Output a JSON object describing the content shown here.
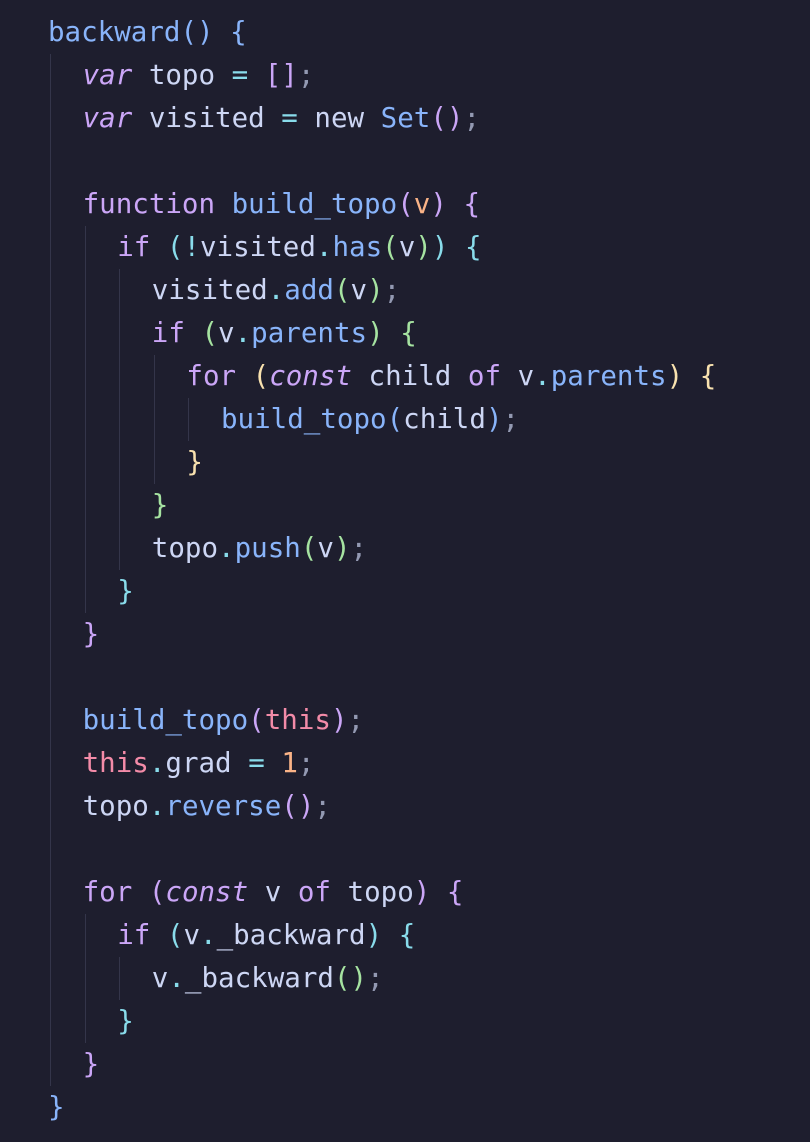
{
  "editor": {
    "lines": [
      {
        "indent": 0,
        "tokens": [
          {
            "t": "backward",
            "c": "fn"
          },
          {
            "t": "()",
            "c": "b6"
          },
          {
            "t": " ",
            "c": "vr"
          },
          {
            "t": "{",
            "c": "b6"
          }
        ]
      },
      {
        "indent": 1,
        "tokens": [
          {
            "t": "var",
            "c": "st"
          },
          {
            "t": " topo ",
            "c": "vr"
          },
          {
            "t": "=",
            "c": "op"
          },
          {
            "t": " ",
            "c": "vr"
          },
          {
            "t": "[]",
            "c": "b2"
          },
          {
            "t": ";",
            "c": "pc"
          }
        ]
      },
      {
        "indent": 1,
        "tokens": [
          {
            "t": "var",
            "c": "st"
          },
          {
            "t": " visited ",
            "c": "vr"
          },
          {
            "t": "=",
            "c": "op"
          },
          {
            "t": " new ",
            "c": "ty"
          },
          {
            "t": "Set",
            "c": "fn"
          },
          {
            "t": "()",
            "c": "b2"
          },
          {
            "t": ";",
            "c": "pc"
          }
        ]
      },
      {
        "indent": 0,
        "tokens": []
      },
      {
        "indent": 1,
        "tokens": [
          {
            "t": "function",
            "c": "kw"
          },
          {
            "t": " ",
            "c": "vr"
          },
          {
            "t": "build_topo",
            "c": "fn"
          },
          {
            "t": "(",
            "c": "b2"
          },
          {
            "t": "v",
            "c": "pm"
          },
          {
            "t": ")",
            "c": "b2"
          },
          {
            "t": " ",
            "c": "vr"
          },
          {
            "t": "{",
            "c": "b2"
          }
        ]
      },
      {
        "indent": 2,
        "tokens": [
          {
            "t": "if",
            "c": "kw"
          },
          {
            "t": " ",
            "c": "vr"
          },
          {
            "t": "(",
            "c": "b3"
          },
          {
            "t": "!",
            "c": "op"
          },
          {
            "t": "visited",
            "c": "vr"
          },
          {
            "t": ".",
            "c": "op"
          },
          {
            "t": "has",
            "c": "fn"
          },
          {
            "t": "(",
            "c": "b4"
          },
          {
            "t": "v",
            "c": "vr"
          },
          {
            "t": ")",
            "c": "b4"
          },
          {
            "t": ")",
            "c": "b3"
          },
          {
            "t": " ",
            "c": "vr"
          },
          {
            "t": "{",
            "c": "b3"
          }
        ]
      },
      {
        "indent": 3,
        "tokens": [
          {
            "t": "visited",
            "c": "vr"
          },
          {
            "t": ".",
            "c": "op"
          },
          {
            "t": "add",
            "c": "fn"
          },
          {
            "t": "(",
            "c": "b4"
          },
          {
            "t": "v",
            "c": "vr"
          },
          {
            "t": ")",
            "c": "b4"
          },
          {
            "t": ";",
            "c": "pc"
          }
        ]
      },
      {
        "indent": 3,
        "tokens": [
          {
            "t": "if",
            "c": "kw"
          },
          {
            "t": " ",
            "c": "vr"
          },
          {
            "t": "(",
            "c": "b4"
          },
          {
            "t": "v",
            "c": "vr"
          },
          {
            "t": ".",
            "c": "op"
          },
          {
            "t": "parents",
            "c": "fn"
          },
          {
            "t": ")",
            "c": "b4"
          },
          {
            "t": " ",
            "c": "vr"
          },
          {
            "t": "{",
            "c": "b4"
          }
        ]
      },
      {
        "indent": 4,
        "tokens": [
          {
            "t": "for",
            "c": "kw"
          },
          {
            "t": " ",
            "c": "vr"
          },
          {
            "t": "(",
            "c": "b5"
          },
          {
            "t": "const",
            "c": "st"
          },
          {
            "t": " child ",
            "c": "vr"
          },
          {
            "t": "of",
            "c": "kw"
          },
          {
            "t": " v",
            "c": "vr"
          },
          {
            "t": ".",
            "c": "op"
          },
          {
            "t": "parents",
            "c": "fn"
          },
          {
            "t": ")",
            "c": "b5"
          },
          {
            "t": " ",
            "c": "vr"
          },
          {
            "t": "{",
            "c": "b5"
          }
        ]
      },
      {
        "indent": 5,
        "tokens": [
          {
            "t": "build_topo",
            "c": "fn"
          },
          {
            "t": "(",
            "c": "b6"
          },
          {
            "t": "child",
            "c": "vr"
          },
          {
            "t": ")",
            "c": "b6"
          },
          {
            "t": ";",
            "c": "pc"
          }
        ]
      },
      {
        "indent": 4,
        "tokens": [
          {
            "t": "}",
            "c": "b5"
          }
        ]
      },
      {
        "indent": 3,
        "tokens": [
          {
            "t": "}",
            "c": "b4"
          }
        ]
      },
      {
        "indent": 3,
        "tokens": [
          {
            "t": "topo",
            "c": "vr"
          },
          {
            "t": ".",
            "c": "op"
          },
          {
            "t": "push",
            "c": "fn"
          },
          {
            "t": "(",
            "c": "b4"
          },
          {
            "t": "v",
            "c": "vr"
          },
          {
            "t": ")",
            "c": "b4"
          },
          {
            "t": ";",
            "c": "pc"
          }
        ]
      },
      {
        "indent": 2,
        "tokens": [
          {
            "t": "}",
            "c": "b3"
          }
        ]
      },
      {
        "indent": 1,
        "tokens": [
          {
            "t": "}",
            "c": "b2"
          }
        ]
      },
      {
        "indent": 0,
        "tokens": []
      },
      {
        "indent": 1,
        "tokens": [
          {
            "t": "build_topo",
            "c": "fn"
          },
          {
            "t": "(",
            "c": "b2"
          },
          {
            "t": "this",
            "c": "sl"
          },
          {
            "t": ")",
            "c": "b2"
          },
          {
            "t": ";",
            "c": "pc"
          }
        ]
      },
      {
        "indent": 1,
        "tokens": [
          {
            "t": "this",
            "c": "sl"
          },
          {
            "t": ".",
            "c": "op"
          },
          {
            "t": "grad ",
            "c": "vr"
          },
          {
            "t": "=",
            "c": "op"
          },
          {
            "t": " ",
            "c": "vr"
          },
          {
            "t": "1",
            "c": "nm"
          },
          {
            "t": ";",
            "c": "pc"
          }
        ]
      },
      {
        "indent": 1,
        "tokens": [
          {
            "t": "topo",
            "c": "vr"
          },
          {
            "t": ".",
            "c": "op"
          },
          {
            "t": "reverse",
            "c": "fn"
          },
          {
            "t": "()",
            "c": "b2"
          },
          {
            "t": ";",
            "c": "pc"
          }
        ]
      },
      {
        "indent": 0,
        "tokens": []
      },
      {
        "indent": 1,
        "tokens": [
          {
            "t": "for",
            "c": "kw"
          },
          {
            "t": " ",
            "c": "vr"
          },
          {
            "t": "(",
            "c": "b2"
          },
          {
            "t": "const",
            "c": "st"
          },
          {
            "t": " v ",
            "c": "vr"
          },
          {
            "t": "of",
            "c": "kw"
          },
          {
            "t": " topo",
            "c": "vr"
          },
          {
            "t": ")",
            "c": "b2"
          },
          {
            "t": " ",
            "c": "vr"
          },
          {
            "t": "{",
            "c": "b2"
          }
        ]
      },
      {
        "indent": 2,
        "tokens": [
          {
            "t": "if",
            "c": "kw"
          },
          {
            "t": " ",
            "c": "vr"
          },
          {
            "t": "(",
            "c": "b3"
          },
          {
            "t": "v",
            "c": "vr"
          },
          {
            "t": ".",
            "c": "op"
          },
          {
            "t": "_backward",
            "c": "vr"
          },
          {
            "t": ")",
            "c": "b3"
          },
          {
            "t": " ",
            "c": "vr"
          },
          {
            "t": "{",
            "c": "b3"
          }
        ]
      },
      {
        "indent": 3,
        "tokens": [
          {
            "t": "v",
            "c": "vr"
          },
          {
            "t": ".",
            "c": "op"
          },
          {
            "t": "_backward",
            "c": "vr"
          },
          {
            "t": "()",
            "c": "b4"
          },
          {
            "t": ";",
            "c": "pc"
          }
        ]
      },
      {
        "indent": 2,
        "tokens": [
          {
            "t": "}",
            "c": "b3"
          }
        ]
      },
      {
        "indent": 1,
        "tokens": [
          {
            "t": "}",
            "c": "b2"
          }
        ]
      },
      {
        "indent": 0,
        "tokens": [
          {
            "t": "}",
            "c": "b6"
          }
        ]
      }
    ]
  },
  "theme": {
    "background": "#1e1e2e",
    "guide": "#34354a"
  }
}
